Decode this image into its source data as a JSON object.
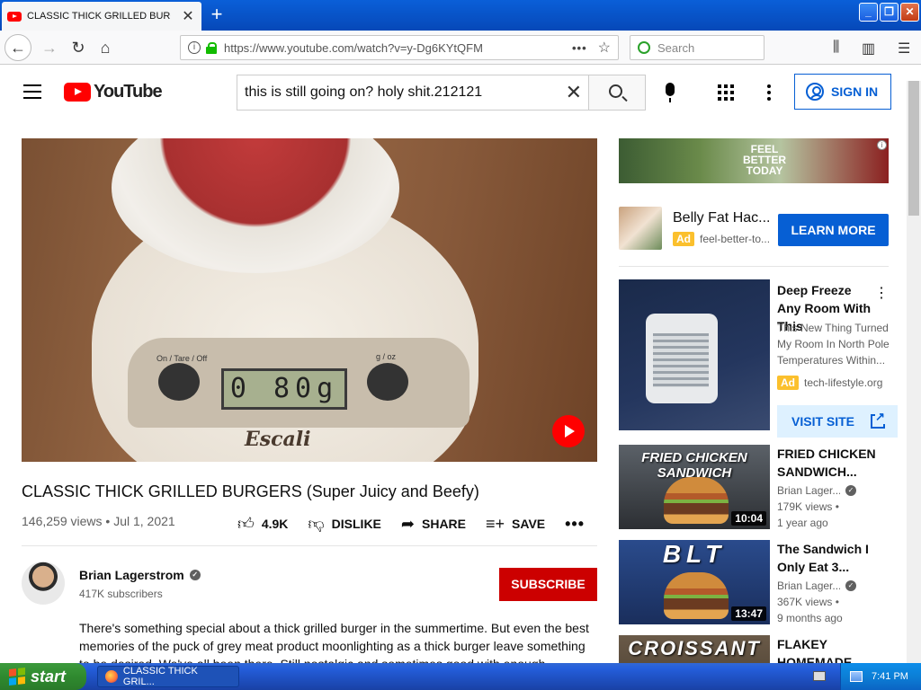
{
  "browser": {
    "tab_title": "CLASSIC THICK GRILLED BURGERS",
    "url": "https://www.youtube.com/watch?v=y-Dg6KYtQFM",
    "search_placeholder": "Search",
    "newtab": "+",
    "tab_close": "✕",
    "url_dots": "•••",
    "star": "☆",
    "buttons": {
      "back": "←",
      "forward": "→",
      "reload": "↻",
      "home": "⌂",
      "library": "⫼",
      "sidebar": "▥",
      "menu": "☰"
    }
  },
  "youtube": {
    "logo_text": "YouTube",
    "search_query": "this is still going on? holy shit.212121",
    "clear": "✕",
    "sign_in": "SIGN IN"
  },
  "video": {
    "title": "CLASSIC THICK GRILLED BURGERS (Super Juicy and Beefy)",
    "views": "146,259 views",
    "date": "Jul 1, 2021",
    "likes": "4.9K",
    "dislike": "DISLIKE",
    "share": "SHARE",
    "save": "SAVE",
    "more": "•••",
    "player": {
      "lcd": "0 80g",
      "brand": "Escali",
      "knob_left_label": "On / Tare / Off",
      "knob_right_label": "g / oz"
    }
  },
  "channel": {
    "name": "Brian Lagerstrom",
    "subscribers": "417K subscribers",
    "subscribe": "SUBSCRIBE",
    "description": "There's something special about a thick grilled burger in the summertime. But even the best memories of the puck of grey meat product moonlighting as a thick burger leave something to be desired. We've all been there. Still nostalgic and sometimes good with enough toppings..."
  },
  "sidebar": {
    "banner_text": "FEEL BETTER TODAY",
    "adinfo": "i",
    "ad1": {
      "title": "Belly Fat Hac...",
      "badge": "Ad",
      "domain": "feel-better-to...",
      "cta": "LEARN MORE"
    },
    "ad2": {
      "title": "Deep Freeze Any Room With This",
      "description": "This New Thing Turned My Room In North Pole Temperatures Within...",
      "badge": "Ad",
      "domain": "tech-lifestyle.org",
      "cta": "VISIT SITE",
      "menu": "⋮"
    },
    "recommendations": [
      {
        "thumb_text": "FRIED CHICKEN SANDWICH",
        "title": "FRIED CHICKEN SANDWICH...",
        "channel": "Brian Lager...",
        "views": "179K views •",
        "age": "1 year ago",
        "duration": "10:04"
      },
      {
        "thumb_text": "BLT",
        "title": "The Sandwich I Only Eat 3...",
        "channel": "Brian Lager...",
        "views": "367K views •",
        "age": "9 months ago",
        "duration": "13:47"
      },
      {
        "thumb_text": "CROISSANT",
        "title": "FLAKEY HOMEMADE",
        "channel": "",
        "views": "",
        "age": "",
        "duration": ""
      }
    ]
  },
  "taskbar": {
    "start": "start",
    "task_item": "CLASSIC THICK GRIL...",
    "time": "7:41 PM"
  }
}
